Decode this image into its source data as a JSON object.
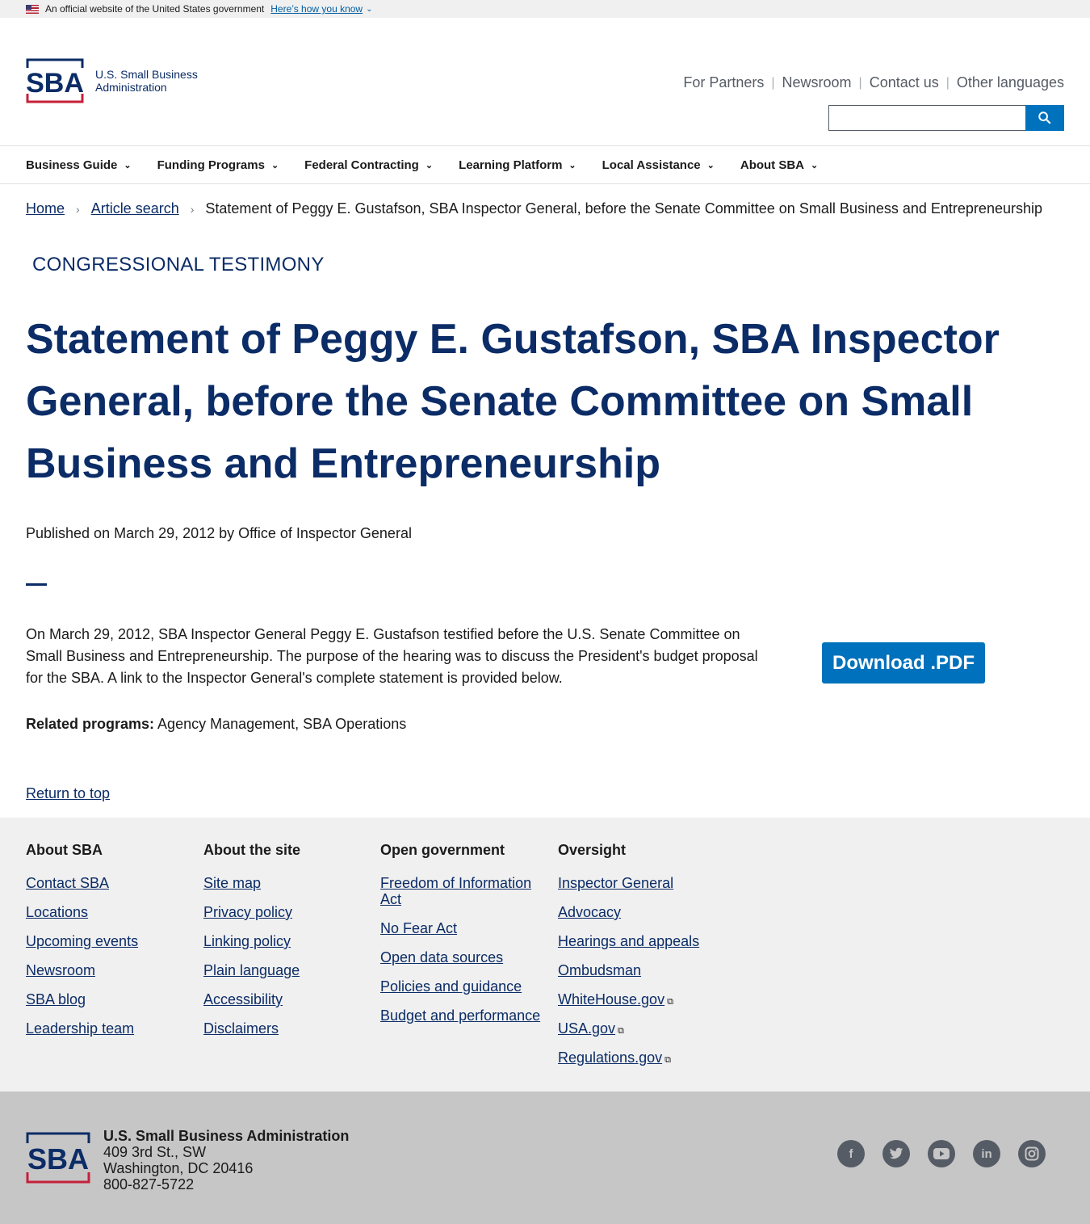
{
  "gov_banner": {
    "text": "An official website of the United States government",
    "howto": "Here’s how you know"
  },
  "logo": {
    "line1": "U.S. Small Business",
    "line2": "Administration"
  },
  "secondary_nav": [
    "For Partners",
    "Newsroom",
    "Contact us",
    "Other languages"
  ],
  "search": {
    "placeholder": ""
  },
  "main_nav": [
    "Business Guide",
    "Funding Programs",
    "Federal Contracting",
    "Learning Platform",
    "Local Assistance",
    "About SBA"
  ],
  "breadcrumb": {
    "home": "Home",
    "article_search": "Article search",
    "current": "Statement of Peggy E. Gustafson, SBA Inspector General, before the Senate Committee on Small Business and Entrepreneurship"
  },
  "eyebrow": "CONGRESSIONAL TESTIMONY",
  "title": "Statement of Peggy E. Gustafson, SBA Inspector General, before the Senate Committee on Small Business and Entrepreneurship",
  "published": "Published on March 29, 2012 by Office of Inspector General",
  "body": "On March 29, 2012,  SBA Inspector General Peggy E. Gustafson testified before the U.S. Senate Committee on Small Business and Entrepreneurship. The purpose of the hearing was to discuss the President's budget proposal for the SBA. A link to the Inspector General's complete statement is provided below.",
  "download_label": "Download .PDF",
  "related": {
    "label": "Related programs:",
    "value": " Agency Management, SBA Operations"
  },
  "return_top": "Return to top",
  "footer": {
    "about": {
      "heading": "About SBA",
      "links": [
        "Contact SBA",
        "Locations",
        "Upcoming events",
        "Newsroom",
        "SBA blog",
        "Leadership team"
      ]
    },
    "site": {
      "heading": "About the site",
      "links": [
        "Site map",
        "Privacy policy",
        "Linking policy",
        "Plain language",
        "Accessibility",
        "Disclaimers"
      ]
    },
    "open_gov": {
      "heading": "Open government",
      "links": [
        "Freedom of Information Act",
        "No Fear Act",
        "Open data sources",
        "Policies and guidance",
        "Budget and performance"
      ]
    },
    "oversight": {
      "heading": "Oversight",
      "links": [
        "Inspector General",
        "Advocacy",
        "Hearings and appeals",
        "Ombudsman",
        "WhiteHouse.gov",
        "USA.gov",
        "Regulations.gov"
      ]
    }
  },
  "address": {
    "org": "U.S. Small Business Administration",
    "street": "409 3rd St., SW",
    "city": "Washington, DC 20416",
    "phone": "800-827-5722"
  },
  "social": [
    "facebook-icon",
    "twitter-icon",
    "youtube-icon",
    "linkedin-icon",
    "instagram-icon"
  ],
  "colors": {
    "navy": "#0b2c66",
    "blue": "#0071bc",
    "red": "#c5203a"
  }
}
